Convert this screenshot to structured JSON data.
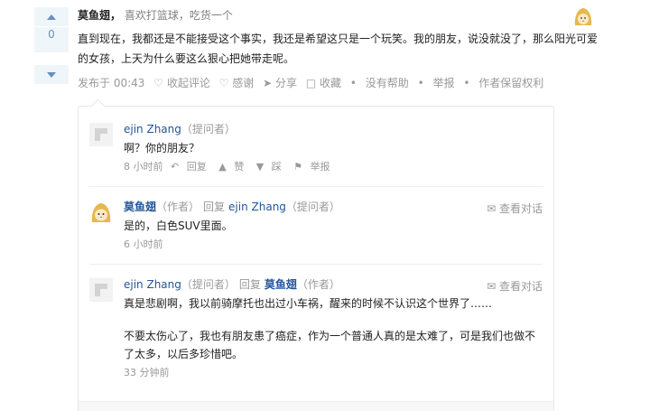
{
  "vote": {
    "count": "0",
    "up_icon": "triangle-up-icon",
    "down_icon": "triangle-down-icon"
  },
  "answer": {
    "author_name": "莫鱼翅，",
    "author_bio": "喜欢打篮球，吃货一个",
    "content": "直到现在，我都还是不能接受这个事实，我还是希望这只是一个玩笑。我的朋友，说没就没了，那么阳光可爱的女孩，上天为什么要这么狠心把她带走呢。",
    "meta": {
      "published": "发布于 00:43",
      "collapse_comments": "收起评论",
      "thanks": "感谢",
      "share": "分享",
      "favorite": "收藏",
      "sep1": "•",
      "not_helpful": "没有帮助",
      "sep2": "•",
      "report": "举报",
      "sep3": "•",
      "copyright": "作者保留权利"
    }
  },
  "comments": [
    {
      "author": "ejin Zhang",
      "role": "（提问者）",
      "text": "啊？你的朋友？",
      "time": "8 小时前",
      "reply": "回复",
      "like": "赞",
      "dislike": "踩",
      "report": "举报"
    },
    {
      "author": "莫鱼翅",
      "role": "（作者）",
      "reply_word": "回复",
      "reply_to": "ejin Zhang",
      "reply_to_role": "（提问者）",
      "view_dialog": "查看对话",
      "text": "是的，白色SUV里面。",
      "time": "6 小时前"
    },
    {
      "author": "ejin Zhang",
      "role": "（提问者）",
      "reply_word": "回复",
      "reply_to": "莫鱼翅",
      "reply_to_role": "（作者）",
      "view_dialog": "查看对话",
      "text1": "真是悲剧啊，我以前骑摩托也出过小车祸，醒来的时候不认识这个世界了……",
      "text2": "不要太伤心了，我也有朋友患了癌症，作为一个普通人真的是太难了，可是我们也做不了太多，以后多珍惜吧。",
      "time": "33 分钟前"
    }
  ],
  "colors": {
    "link": "#225599",
    "muted": "#999999",
    "vote_bg": "#eff6fa",
    "vote_fg": "#698ebf"
  }
}
